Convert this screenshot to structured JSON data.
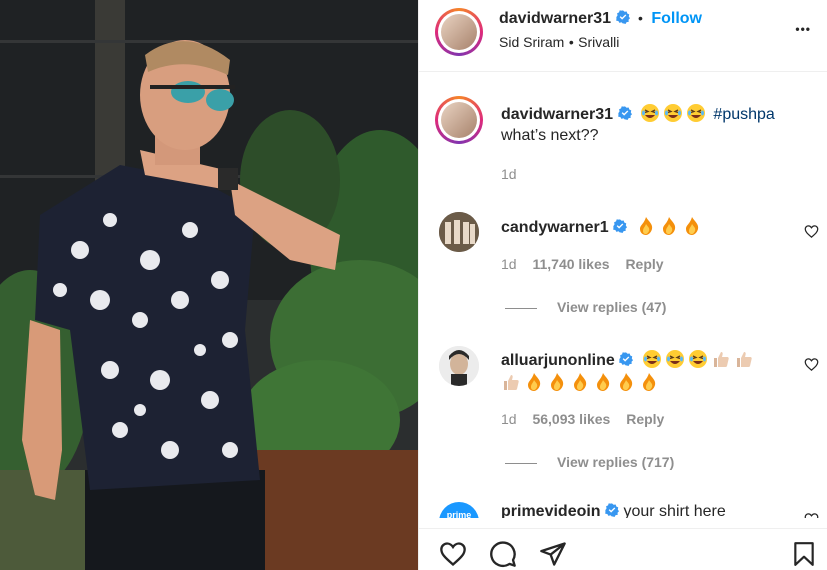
{
  "post": {
    "author": "davidwarner31",
    "follow_label": "Follow",
    "dot": "•",
    "audio_artist": "Sid Sriram",
    "audio_song": "Srivalli",
    "more_label": "•••"
  },
  "caption": {
    "author": "davidwarner31",
    "emojis": [
      "laughing-tears-emoji",
      "laughing-tears-emoji",
      "laughing-tears-emoji"
    ],
    "hashtag": "#pushpa",
    "text": "what’s next??",
    "time": "1d"
  },
  "comments": [
    {
      "author": "candywarner1",
      "emojis": [
        "fire-emoji",
        "fire-emoji",
        "fire-emoji"
      ],
      "time": "1d",
      "likes": "11,740 likes",
      "reply_label": "Reply",
      "view_replies": "View replies (47)"
    },
    {
      "author": "alluarjunonline",
      "emojis_line1": [
        "laughing-tears-emoji",
        "laughing-tears-emoji",
        "laughing-tears-emoji",
        "thumbs-up-emoji",
        "thumbs-up-emoji"
      ],
      "emojis_line2": [
        "thumbs-up-emoji",
        "fire-emoji",
        "fire-emoji",
        "fire-emoji",
        "fire-emoji",
        "fire-emoji",
        "fire-emoji"
      ],
      "time": "1d",
      "likes": "56,093 likes",
      "reply_label": "Reply",
      "view_replies": "View replies (717)"
    },
    {
      "author": "primevideoin",
      "avatar_text": "prime",
      "text": "your shirt here"
    }
  ],
  "colors": {
    "accent": "#0095f6",
    "hashtag": "#00376b",
    "verified": "#3897f0",
    "muted": "#8e8e8e"
  }
}
